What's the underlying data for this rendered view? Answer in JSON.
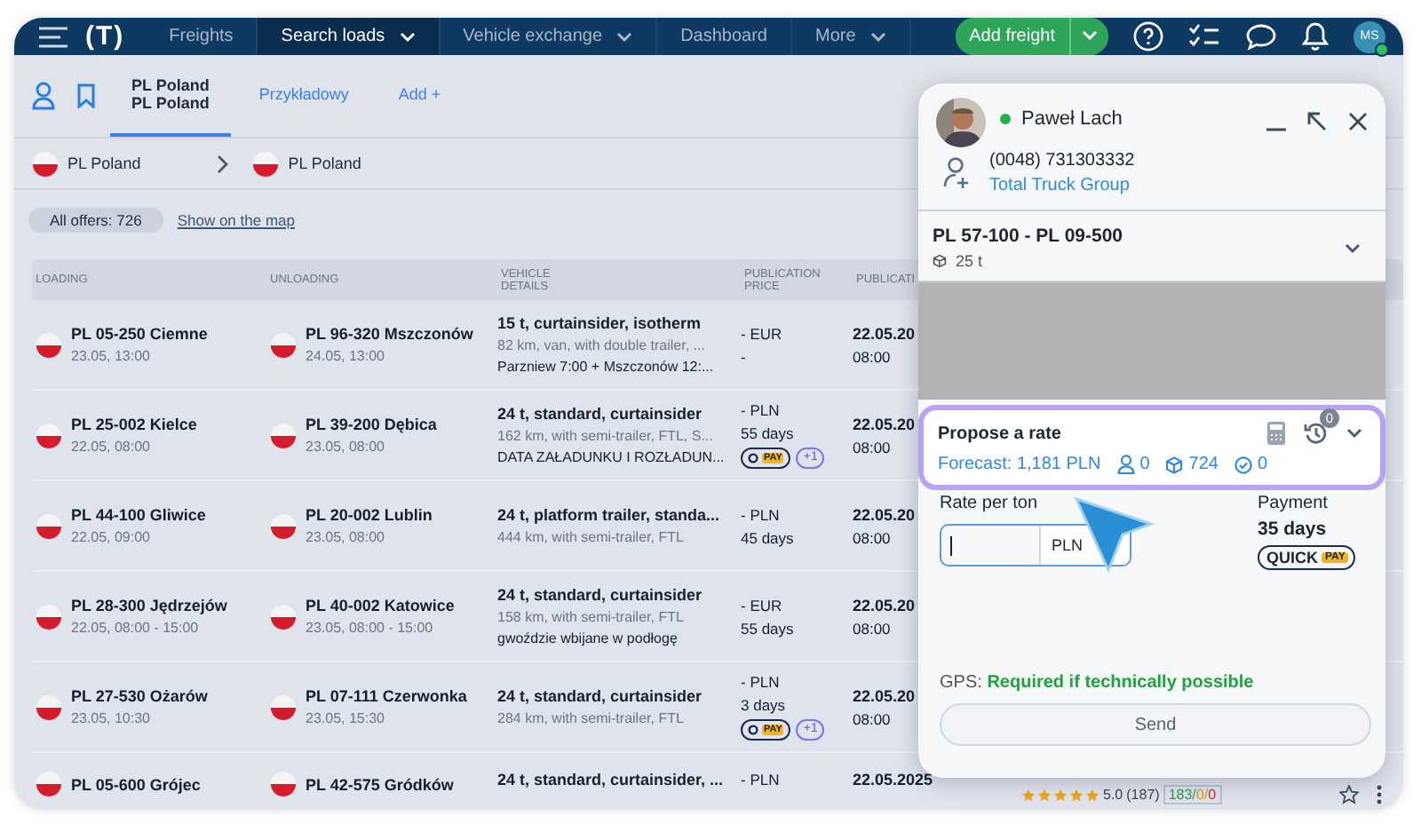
{
  "nav": {
    "logo": "(T)",
    "items": [
      {
        "label": "Freights",
        "selected": false,
        "dropdown": false
      },
      {
        "label": "Search loads",
        "selected": true,
        "dropdown": true
      },
      {
        "label": "Vehicle exchange",
        "selected": false,
        "dropdown": true
      },
      {
        "label": "Dashboard",
        "selected": false,
        "dropdown": false
      },
      {
        "label": "More",
        "selected": false,
        "dropdown": true
      }
    ],
    "add_button": "Add freight",
    "avatar": "MS"
  },
  "filters": {
    "tabs": [
      {
        "lines": [
          "PL Poland",
          "PL Poland"
        ],
        "selected": true
      },
      {
        "lines": [
          "Przykładowy"
        ],
        "selected": false
      },
      {
        "lines": [
          "Add +"
        ],
        "selected": false
      }
    ],
    "route": {
      "from": "PL Poland",
      "to": "PL Poland"
    },
    "offers": {
      "label": "All offers:",
      "count": "726",
      "map_link": "Show on the map"
    }
  },
  "table": {
    "columns": [
      "LOADING",
      "UNLOADING",
      "VEHICLE DETAILS",
      "PUBLICATION PRICE",
      "PUBLICATI"
    ],
    "rows": [
      {
        "loading": {
          "place": "PL 05-250 Ciemne",
          "time": "23.05, 13:00"
        },
        "unloading": {
          "place": "PL 96-320 Mszczonów",
          "time": "24.05, 13:00"
        },
        "vehicle": {
          "main": "15 t, curtainsider, isotherm",
          "sub": "82 km, van, with double trailer, ...",
          "note": "Parzniew 7:00 + Mszczonów 12:..."
        },
        "price": {
          "amount": "- EUR",
          "term": "-"
        },
        "published": {
          "date": "22.05.20",
          "time": "08:00"
        }
      },
      {
        "loading": {
          "place": "PL 25-002 Kielce",
          "time": "22.05, 08:00"
        },
        "unloading": {
          "place": "PL 39-200 Dębica",
          "time": "23.05, 08:00"
        },
        "vehicle": {
          "main": "24 t, standard, curtainsider",
          "sub": "162 km, with semi-trailer, FTL, S...",
          "note": "DATA ZAŁADUNKU I ROZŁADUN..."
        },
        "price": {
          "amount": "- PLN",
          "term": "55 days",
          "pay_badge": "PAY",
          "extra": "+1"
        },
        "published": {
          "date": "22.05.20",
          "time": "08:00"
        }
      },
      {
        "loading": {
          "place": "PL 44-100 Gliwice",
          "time": "22.05, 09:00"
        },
        "unloading": {
          "place": "PL 20-002 Lublin",
          "time": "23.05, 08:00"
        },
        "vehicle": {
          "main": "24 t, platform trailer, standa...",
          "sub": "444 km, with semi-trailer, FTL"
        },
        "price": {
          "amount": "- PLN",
          "term": "45 days"
        },
        "published": {
          "date": "22.05.20",
          "time": "08:00"
        }
      },
      {
        "loading": {
          "place": "PL 28-300 Jędrzejów",
          "time": "22.05, 08:00 - 15:00"
        },
        "unloading": {
          "place": "PL 40-002 Katowice",
          "time": "23.05, 08:00 - 15:00"
        },
        "vehicle": {
          "main": "24 t, standard, curtainsider",
          "sub": "158 km, with semi-trailer, FTL",
          "note": "gwoździe wbijane w podłogę"
        },
        "price": {
          "amount": "- EUR",
          "term": "55 days"
        },
        "published": {
          "date": "22.05.20",
          "time": "08:00"
        }
      },
      {
        "loading": {
          "place": "PL 27-530 Ożarów",
          "time": "23.05, 10:30"
        },
        "unloading": {
          "place": "PL 07-111 Czerwonka",
          "time": "23.05, 15:30"
        },
        "vehicle": {
          "main": "24 t, standard, curtainsider",
          "sub": "284 km, with semi-trailer, FTL"
        },
        "price": {
          "amount": "- PLN",
          "term": "3 days",
          "pay_badge": "PAY",
          "extra": "+1"
        },
        "published": {
          "date": "22.05.20",
          "time": "08:00"
        }
      },
      {
        "loading": {
          "place": "PL 05-600 Grójec"
        },
        "unloading": {
          "place": "PL 42-575 Gródków"
        },
        "vehicle": {
          "main": "24 t, standard, curtainsider, ..."
        },
        "price": {
          "amount": "- PLN"
        },
        "published": {
          "date": "22.05.2025"
        },
        "rating": {
          "stars": 5,
          "score": "5.0",
          "count": "(187)",
          "positive": "183/",
          "neutral": "0/",
          "negative": "0"
        }
      }
    ]
  },
  "panel": {
    "contact": {
      "name": "Paweł Lach",
      "online": true,
      "phone": "(0048) 731303332",
      "company": "Total Truck Group"
    },
    "route": {
      "title": "PL 57-100 - PL 09-500",
      "weight": "25 t"
    },
    "proposal": {
      "title": "Propose a rate",
      "history_count": "0",
      "forecast": "Forecast: 1,181 PLN",
      "people": "0",
      "offers": "724",
      "accepted": "0"
    },
    "rate": {
      "label": "Rate per ton",
      "currency": "PLN"
    },
    "payment": {
      "label": "Payment",
      "term": "35 days",
      "quick": "QUICK",
      "pay": "PAY"
    },
    "gps": {
      "label": "GPS:",
      "value": "Required if technically possible"
    },
    "send": "Send"
  }
}
